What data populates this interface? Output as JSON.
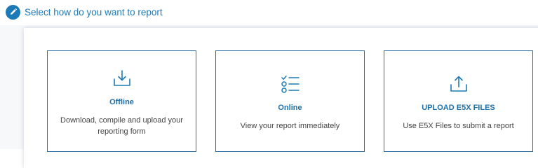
{
  "header": {
    "title": "Select how do you want to report",
    "icon": "pencil-icon"
  },
  "colors": {
    "accent": "#1d7ab8",
    "card_border": "#2f6ea3",
    "text": "#444444"
  },
  "options": [
    {
      "title": "Offline",
      "description": "Download, compile and upload your reporting form",
      "icon": "download-icon"
    },
    {
      "title": "Online",
      "description": "View your report immediately",
      "icon": "checklist-icon"
    },
    {
      "title": "UPLOAD E5X FILES",
      "description": "Use E5X Files to submit a report",
      "icon": "upload-icon"
    }
  ]
}
